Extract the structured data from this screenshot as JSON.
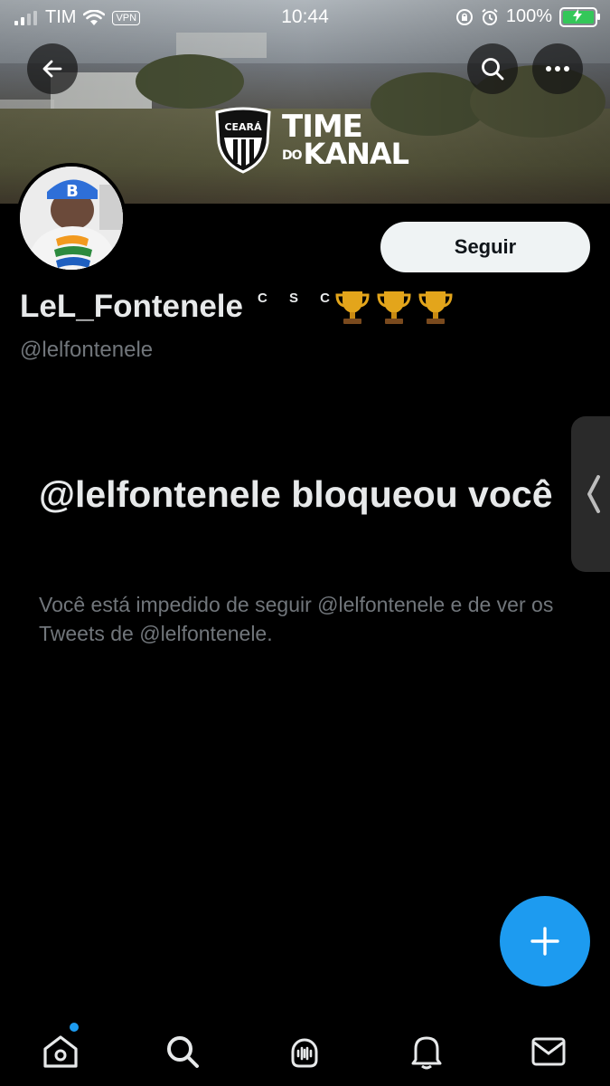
{
  "status_bar": {
    "carrier": "TIM",
    "vpn": "VPN",
    "time": "10:44",
    "battery_percent": "100%",
    "battery_level": 1.0,
    "battery_charging": true
  },
  "banner": {
    "logo_crest_text": "CEARÁ",
    "brand_line1": "TIME",
    "brand_do": "DO",
    "brand_line2": "KANAL"
  },
  "profile": {
    "follow_label": "Seguir",
    "display_name": "LeL_Fontenele",
    "name_suffix": "C S C",
    "name_emoji_count": 3,
    "handle": "@lelfontenele"
  },
  "blocked": {
    "title": "@lelfontenele bloqueou você",
    "description": "Você está impedido de seguir @lelfontenele e de ver os Tweets de @lelfontenele."
  },
  "colors": {
    "accent": "#1d9bf0",
    "background": "#000000",
    "secondary_text": "#71767b",
    "button_bg": "#eff3f4"
  },
  "icons": {
    "back": "arrow-left-icon",
    "search": "search-icon",
    "more": "more-horizontal-icon",
    "fab": "plus-icon",
    "tabs": [
      "home-icon",
      "search-icon",
      "spaces-icon",
      "bell-icon",
      "mail-icon"
    ]
  }
}
